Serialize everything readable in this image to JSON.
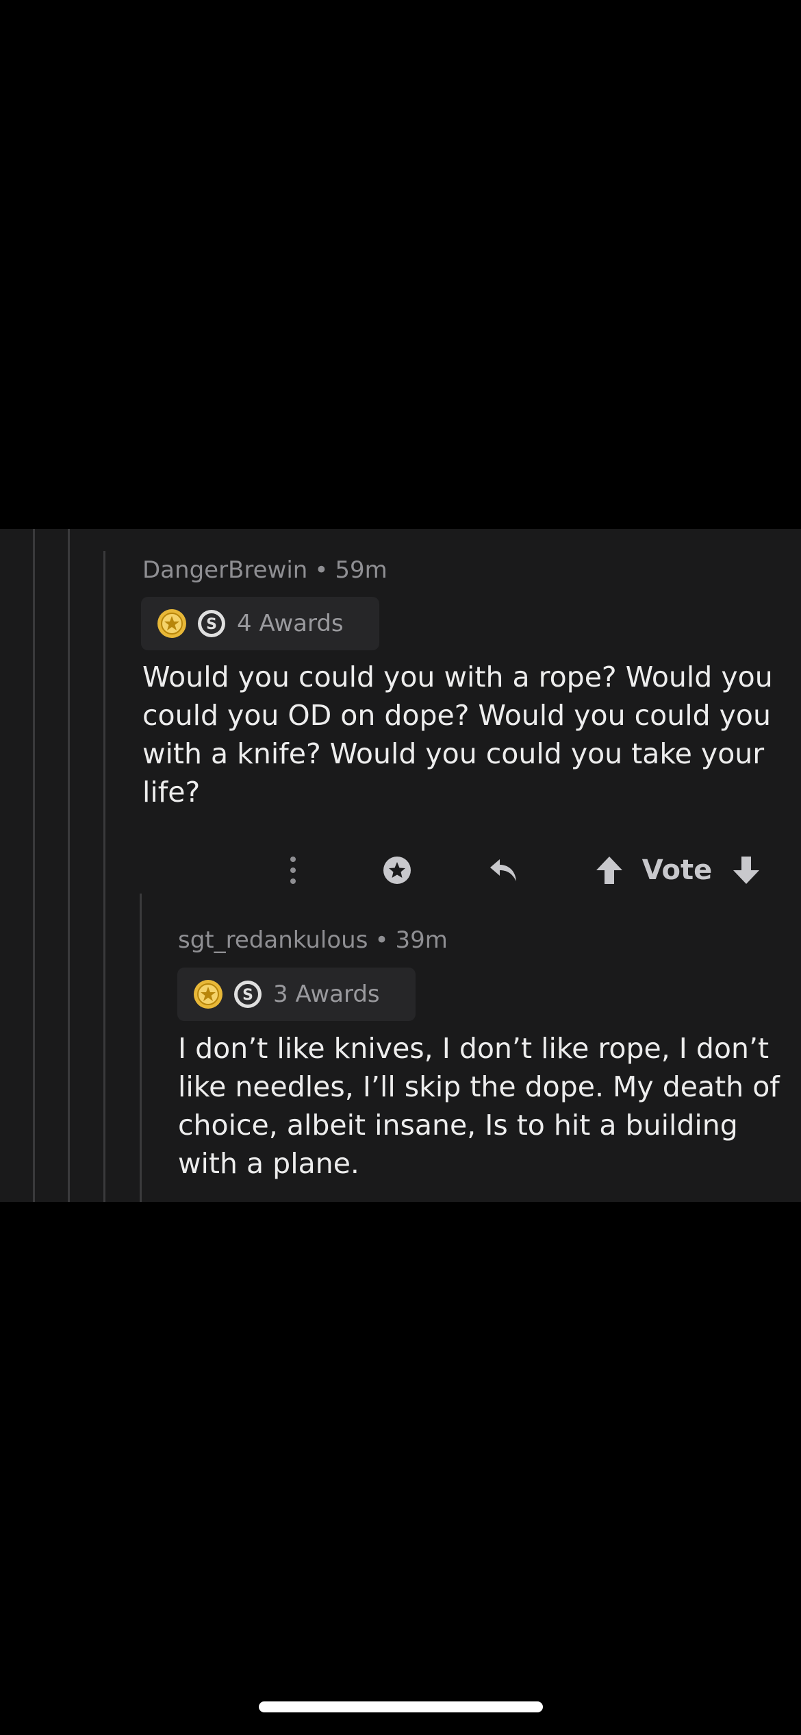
{
  "comments": [
    {
      "username": "DangerBrewin",
      "separator": "•",
      "time": "59m",
      "awards_label": "4 Awards",
      "body": "Would you could you with a rope? Would you could you OD on dope? Would you could you with a knife? Would you could you take your life?"
    },
    {
      "username": "sgt_redankulous",
      "separator": "•",
      "time": "39m",
      "awards_label": "3 Awards",
      "body": "I don’t like knives, I don’t like rope, I don’t like needles, I’ll skip the dope. My death of choice, albeit insane, Is to hit a building with a plane."
    }
  ],
  "actions": {
    "vote_label": "Vote",
    "icons": [
      "more-options-icon",
      "award-icon",
      "reply-icon",
      "upvote-icon",
      "downvote-icon"
    ]
  },
  "colors": {
    "background": "#000000",
    "panel": "#1a1a1b",
    "thread_line": "#3a3a3c",
    "meta_text": "#8f8f93",
    "body_text": "#ededed",
    "award_gold": "#e8b838",
    "award_silver": "#e0e0e0"
  }
}
